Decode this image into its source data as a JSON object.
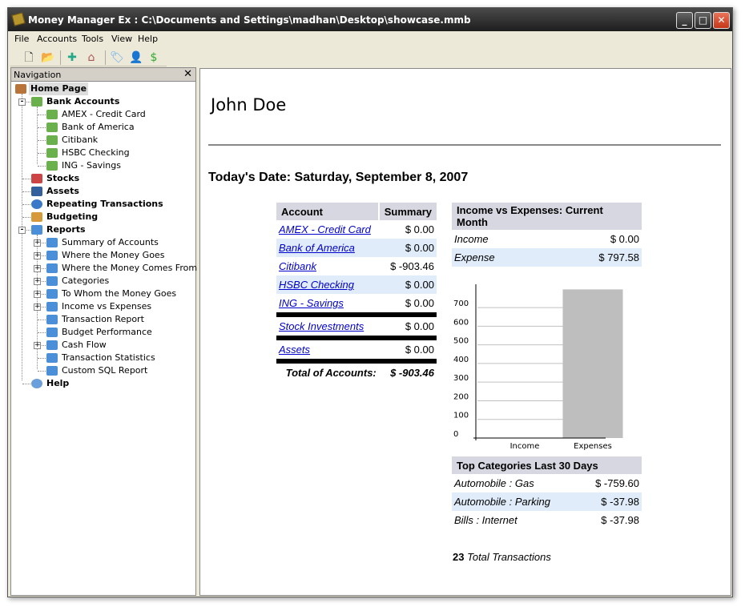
{
  "window": {
    "title": "Money Manager Ex : C:\\Documents and Settings\\madhan\\Desktop\\showcase.mmb"
  },
  "menu": [
    "File",
    "Accounts",
    "Tools",
    "View",
    "Help"
  ],
  "toolbar": [
    {
      "icon": "new-file-icon",
      "g": "🗋"
    },
    {
      "icon": "open-folder-icon",
      "g": "📂"
    },
    {
      "icon": "new-account-icon",
      "g": "✚"
    },
    {
      "icon": "home-icon",
      "g": "⌂"
    },
    {
      "icon": "tag-icon",
      "g": "🏷"
    },
    {
      "icon": "payee-icon",
      "g": "👤"
    },
    {
      "icon": "currency-icon",
      "g": "$"
    }
  ],
  "nav": {
    "title": "Navigation",
    "items": [
      {
        "label": "Home Page",
        "lvl": 0,
        "bold": true,
        "icon": "home-icon"
      },
      {
        "label": "Bank Accounts",
        "lvl": 1,
        "bold": true,
        "exp": "-",
        "icon": "money-icon"
      },
      {
        "label": "AMEX - Credit Card",
        "lvl": 2,
        "icon": "money-icon"
      },
      {
        "label": "Bank of America",
        "lvl": 2,
        "icon": "money-icon"
      },
      {
        "label": "Citibank",
        "lvl": 2,
        "icon": "money-icon"
      },
      {
        "label": "HSBC Checking",
        "lvl": 2,
        "icon": "money-icon"
      },
      {
        "label": "ING - Savings",
        "lvl": 2,
        "icon": "money-icon"
      },
      {
        "label": "Stocks",
        "lvl": 1,
        "bold": true,
        "icon": "stocks-icon"
      },
      {
        "label": "Assets",
        "lvl": 1,
        "bold": true,
        "icon": "car-icon"
      },
      {
        "label": "Repeating Transactions",
        "lvl": 1,
        "bold": true,
        "icon": "clock-icon"
      },
      {
        "label": "Budgeting",
        "lvl": 1,
        "bold": true,
        "icon": "calculator-icon"
      },
      {
        "label": "Reports",
        "lvl": 1,
        "bold": true,
        "exp": "-",
        "icon": "report-icon"
      },
      {
        "label": "Summary of Accounts",
        "lvl": 2,
        "exp": "+",
        "icon": "report-icon"
      },
      {
        "label": "Where the Money Goes",
        "lvl": 2,
        "exp": "+",
        "icon": "report-icon"
      },
      {
        "label": "Where the Money Comes From",
        "lvl": 2,
        "exp": "+",
        "icon": "report-icon"
      },
      {
        "label": "Categories",
        "lvl": 2,
        "exp": "+",
        "icon": "report-icon"
      },
      {
        "label": "To Whom the Money Goes",
        "lvl": 2,
        "exp": "+",
        "icon": "report-icon"
      },
      {
        "label": "Income vs Expenses",
        "lvl": 2,
        "exp": "+",
        "icon": "report-icon"
      },
      {
        "label": "Transaction Report",
        "lvl": 2,
        "icon": "report-icon"
      },
      {
        "label": "Budget Performance",
        "lvl": 2,
        "icon": "report-icon"
      },
      {
        "label": "Cash Flow",
        "lvl": 2,
        "exp": "+",
        "icon": "report-icon"
      },
      {
        "label": "Transaction Statistics",
        "lvl": 2,
        "icon": "report-icon"
      },
      {
        "label": "Custom SQL Report",
        "lvl": 2,
        "icon": "report-icon"
      },
      {
        "label": "Help",
        "lvl": 1,
        "bold": true,
        "icon": "help-icon"
      }
    ]
  },
  "home": {
    "user": "John Doe",
    "date": "Today's Date: Saturday, September 8, 2007",
    "accounts": {
      "headers": [
        "Account",
        "Summary"
      ],
      "rows": [
        {
          "name": "AMEX - Credit Card",
          "value": "$ 0.00"
        },
        {
          "name": "Bank of America",
          "value": "$ 0.00"
        },
        {
          "name": "Citibank",
          "value": "$ -903.46"
        },
        {
          "name": "HSBC Checking",
          "value": "$ 0.00"
        },
        {
          "name": "ING - Savings",
          "value": "$ 0.00"
        }
      ],
      "stock": {
        "name": "Stock Investments",
        "value": "$ 0.00"
      },
      "assets": {
        "name": "Assets",
        "value": "$ 0.00"
      },
      "total_label": "Total of Accounts:",
      "total_value": "$ -903.46"
    },
    "income_expenses": {
      "title": "Income vs Expenses: Current Month",
      "rows": [
        {
          "label": "Income",
          "value": "$ 0.00"
        },
        {
          "label": "Expense",
          "value": "$ 797.58"
        }
      ]
    },
    "top_categories": {
      "title": "Top Categories Last 30 Days",
      "rows": [
        {
          "label": "Automobile : Gas",
          "value": "$ -759.60"
        },
        {
          "label": "Automobile : Parking",
          "value": "$ -37.98"
        },
        {
          "label": "Bills : Internet",
          "value": "$ -37.98"
        }
      ]
    },
    "total_transactions": {
      "count": "23",
      "label": "Total Transactions"
    }
  },
  "chart_data": {
    "type": "bar",
    "categories": [
      "Income",
      "Expenses"
    ],
    "values": [
      0,
      797.58
    ],
    "yticks": [
      0,
      100,
      200,
      300,
      400,
      500,
      600,
      700
    ],
    "ylim": [
      0,
      825
    ],
    "grid": true,
    "bar_color": "#bebebe"
  }
}
